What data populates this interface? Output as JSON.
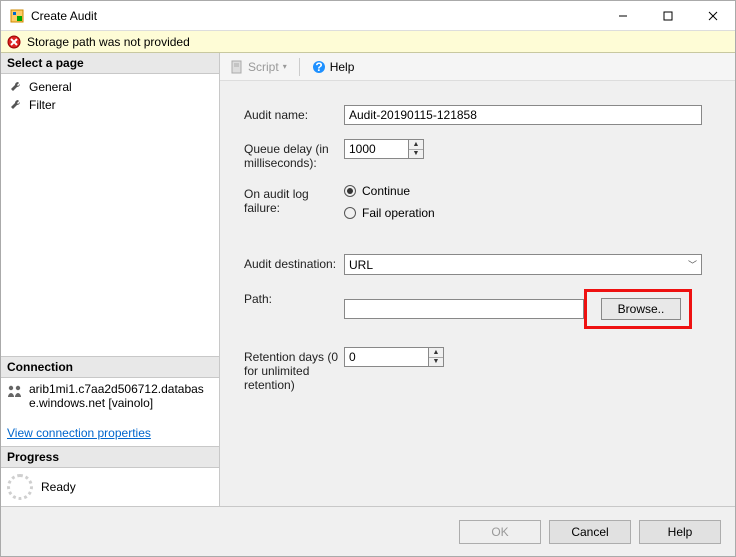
{
  "window": {
    "title": "Create Audit"
  },
  "error": {
    "message": "Storage path was not provided"
  },
  "left": {
    "select_page_header": "Select a page",
    "pages": [
      {
        "label": "General"
      },
      {
        "label": "Filter"
      }
    ],
    "connection_header": "Connection",
    "connection_text": "arib1mi1.c7aa2d506712.database.windows.net [vainolo]",
    "view_props_link": "View connection properties",
    "progress_header": "Progress",
    "progress_status": "Ready"
  },
  "toolbar": {
    "script_label": "Script",
    "help_label": "Help"
  },
  "form": {
    "audit_name_label": "Audit name:",
    "audit_name_value": "Audit-20190115-121858",
    "queue_delay_label": "Queue delay (in milliseconds):",
    "queue_delay_value": "1000",
    "on_failure_label": "On audit log failure:",
    "on_failure_options": {
      "continue": "Continue",
      "fail": "Fail operation"
    },
    "on_failure_selected": "continue",
    "audit_dest_label": "Audit destination:",
    "audit_dest_value": "URL",
    "path_label": "Path:",
    "path_value": "",
    "browse_label": "Browse..",
    "retention_label": "Retention days (0 for unlimited retention)",
    "retention_value": "0"
  },
  "footer": {
    "ok": "OK",
    "cancel": "Cancel",
    "help": "Help"
  }
}
